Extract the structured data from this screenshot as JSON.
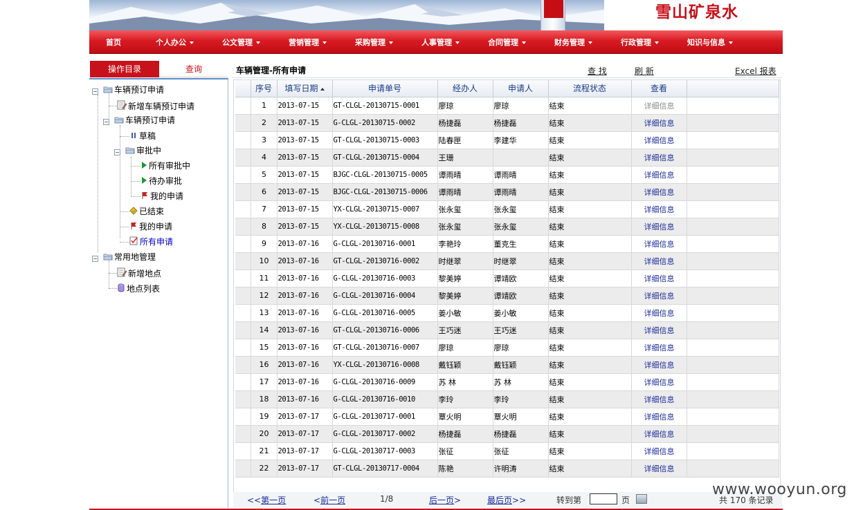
{
  "brand": {
    "title": "雪山矿泉水"
  },
  "nav": [
    {
      "label": "首页",
      "dropdown": false
    },
    {
      "label": "个人办公",
      "dropdown": true
    },
    {
      "label": "公文管理",
      "dropdown": true
    },
    {
      "label": "营销管理",
      "dropdown": true
    },
    {
      "label": "采购管理",
      "dropdown": true
    },
    {
      "label": "人事管理",
      "dropdown": true
    },
    {
      "label": "合同管理",
      "dropdown": true
    },
    {
      "label": "财务管理",
      "dropdown": true
    },
    {
      "label": "行政管理",
      "dropdown": true
    },
    {
      "label": "知识与信息",
      "dropdown": true
    }
  ],
  "left_tabs": {
    "ops": "操作目录",
    "query": "查询"
  },
  "tree": {
    "n1": "车辆预订申请",
    "n1_1": "新增车辆预订申请",
    "n1_2": "车辆预订申请",
    "n1_2_1": "草稿",
    "n1_2_2": "审批中",
    "n1_2_2_1": "所有审批中",
    "n1_2_2_2": "待办审批",
    "n1_2_2_3": "我的申请",
    "n1_2_3": "已结束",
    "n1_2_4": "我的申请",
    "n1_2_5": "所有申请",
    "n2": "常用地管理",
    "n2_1": "新增地点",
    "n2_2": "地点列表"
  },
  "right": {
    "title": "车辆管理-所有申请",
    "find": "查 找",
    "refresh": "刷 新",
    "export": "Excel 报表"
  },
  "table": {
    "headers": {
      "seq": "序号",
      "date": "填写日期",
      "no": "申请单号",
      "handler": "经办人",
      "applicant": "申请人",
      "status": "流程状态",
      "view": "查看"
    },
    "link_label": "详细信息",
    "rows": [
      {
        "seq": "1",
        "date": "2013-07-15",
        "no": "GT-CLGL-20130715-0001",
        "handler": "廖琼",
        "applicant": "廖琼",
        "status": "结束"
      },
      {
        "seq": "2",
        "date": "2013-07-15",
        "no": "G-CLGL-20130715-0002",
        "handler": "杨捷磊",
        "applicant": "杨捷磊",
        "status": "结束"
      },
      {
        "seq": "3",
        "date": "2013-07-15",
        "no": "GT-CLGL-20130715-0003",
        "handler": "陆春匣",
        "applicant": "李建华",
        "status": "结束"
      },
      {
        "seq": "4",
        "date": "2013-07-15",
        "no": "GT-CLGL-20130715-0004",
        "handler": "王珊",
        "applicant": "",
        "status": "结束"
      },
      {
        "seq": "5",
        "date": "2013-07-15",
        "no": "BJGC-CLGL-20130715-0005",
        "handler": "谭雨晴",
        "applicant": "谭雨晴",
        "status": "结束"
      },
      {
        "seq": "6",
        "date": "2013-07-15",
        "no": "BJGC-CLGL-20130715-0006",
        "handler": "谭雨晴",
        "applicant": "谭雨晴",
        "status": "结束"
      },
      {
        "seq": "7",
        "date": "2013-07-15",
        "no": "YX-CLGL-20130715-0007",
        "handler": "张永玺",
        "applicant": "张永玺",
        "status": "结束"
      },
      {
        "seq": "8",
        "date": "2013-07-15",
        "no": "YX-CLGL-20130715-0008",
        "handler": "张永玺",
        "applicant": "张永玺",
        "status": "结束"
      },
      {
        "seq": "9",
        "date": "2013-07-16",
        "no": "G-CLGL-20130716-0001",
        "handler": "李艳玲",
        "applicant": "董克生",
        "status": "结束"
      },
      {
        "seq": "10",
        "date": "2013-07-16",
        "no": "GT-CLGL-20130716-0002",
        "handler": "时继翠",
        "applicant": "时继翠",
        "status": "结束"
      },
      {
        "seq": "11",
        "date": "2013-07-16",
        "no": "G-CLGL-20130716-0003",
        "handler": "黎美婷",
        "applicant": "谭靖欧",
        "status": "结束"
      },
      {
        "seq": "12",
        "date": "2013-07-16",
        "no": "G-CLGL-20130716-0004",
        "handler": "黎美婷",
        "applicant": "谭靖欧",
        "status": "结束"
      },
      {
        "seq": "13",
        "date": "2013-07-16",
        "no": "G-CLGL-20130716-0005",
        "handler": "姜小敏",
        "applicant": "姜小敏",
        "status": "结束"
      },
      {
        "seq": "14",
        "date": "2013-07-16",
        "no": "GT-CLGL-20130716-0006",
        "handler": "王巧迷",
        "applicant": "王巧迷",
        "status": "结束"
      },
      {
        "seq": "15",
        "date": "2013-07-16",
        "no": "GT-CLGL-20130716-0007",
        "handler": "廖琼",
        "applicant": "廖琼",
        "status": "结束"
      },
      {
        "seq": "16",
        "date": "2013-07-16",
        "no": "YX-CLGL-20130716-0008",
        "handler": "戴钰颖",
        "applicant": "戴钰颖",
        "status": "结束"
      },
      {
        "seq": "17",
        "date": "2013-07-16",
        "no": "G-CLGL-20130716-0009",
        "handler": "苏 林",
        "applicant": "苏 林",
        "status": "结束"
      },
      {
        "seq": "18",
        "date": "2013-07-16",
        "no": "G-CLGL-20130716-0010",
        "handler": "李玲",
        "applicant": "李玲",
        "status": "结束"
      },
      {
        "seq": "19",
        "date": "2013-07-17",
        "no": "G-CLGL-20130717-0001",
        "handler": "覃火明",
        "applicant": "覃火明",
        "status": "结束"
      },
      {
        "seq": "20",
        "date": "2013-07-17",
        "no": "G-CLGL-20130717-0002",
        "handler": "杨捷磊",
        "applicant": "杨捷磊",
        "status": "结束"
      },
      {
        "seq": "21",
        "date": "2013-07-17",
        "no": "G-CLGL-20130717-0003",
        "handler": "张征",
        "applicant": "张征",
        "status": "结束"
      },
      {
        "seq": "22",
        "date": "2013-07-17",
        "no": "GT-CLGL-20130717-0004",
        "handler": "陈艳",
        "applicant": "许明涛",
        "status": "结束"
      }
    ]
  },
  "pager": {
    "first": "第一页",
    "first_prefix": "<<",
    "prev": "前一页",
    "prev_prefix": "<",
    "page_info": "1/8",
    "next": "后一页",
    "next_suffix": ">",
    "last": "最后页",
    "last_suffix": ">>",
    "goto": "转到第",
    "page_unit": "页",
    "total": "共 170 条记录"
  },
  "watermark": "www.wooyun.org",
  "colors": {
    "nav_red": "#d81a22",
    "tab_red": "#c8121b",
    "link_blue": "#1a2a9a"
  }
}
